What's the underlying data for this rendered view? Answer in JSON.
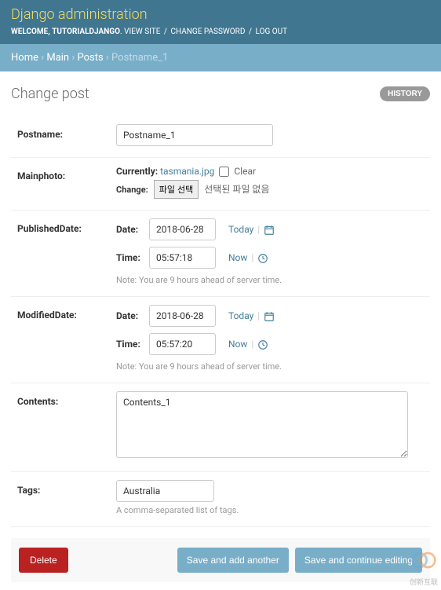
{
  "header": {
    "branding": "Django administration",
    "welcome": "WELCOME,",
    "username": "TUTORIALDJANGO",
    "view_site": "VIEW SITE",
    "change_password": "CHANGE PASSWORD",
    "logout": "LOG OUT"
  },
  "breadcrumbs": {
    "home": "Home",
    "app": "Main",
    "model": "Posts",
    "current": "Postname_1"
  },
  "page": {
    "title": "Change post",
    "history_btn": "HISTORY"
  },
  "form": {
    "postname": {
      "label": "Postname:",
      "value": "Postname_1"
    },
    "mainphoto": {
      "label": "Mainphoto:",
      "currently": "Currently:",
      "filename": "tasmania.jpg",
      "clear": "Clear",
      "change": "Change:",
      "file_btn": "파일 선택",
      "file_status": "선택된 파일 없음"
    },
    "published": {
      "label": "PublishedDate:",
      "date_label": "Date:",
      "time_label": "Time:",
      "date": "2018-06-28",
      "time": "05:57:18",
      "today": "Today",
      "now": "Now",
      "tz_note": "Note: You are 9 hours ahead of server time."
    },
    "modified": {
      "label": "ModifiedDate:",
      "date_label": "Date:",
      "time_label": "Time:",
      "date": "2018-06-28",
      "time": "05:57:20",
      "today": "Today",
      "now": "Now",
      "tz_note": "Note: You are 9 hours ahead of server time."
    },
    "contents": {
      "label": "Contents:",
      "value": "Contents_1"
    },
    "tags": {
      "label": "Tags:",
      "value": "Australia",
      "help": "A comma-separated list of tags."
    }
  },
  "actions": {
    "delete": "Delete",
    "save_add": "Save and add another",
    "save_continue": "Save and continue editing"
  },
  "watermark": "创新互联"
}
